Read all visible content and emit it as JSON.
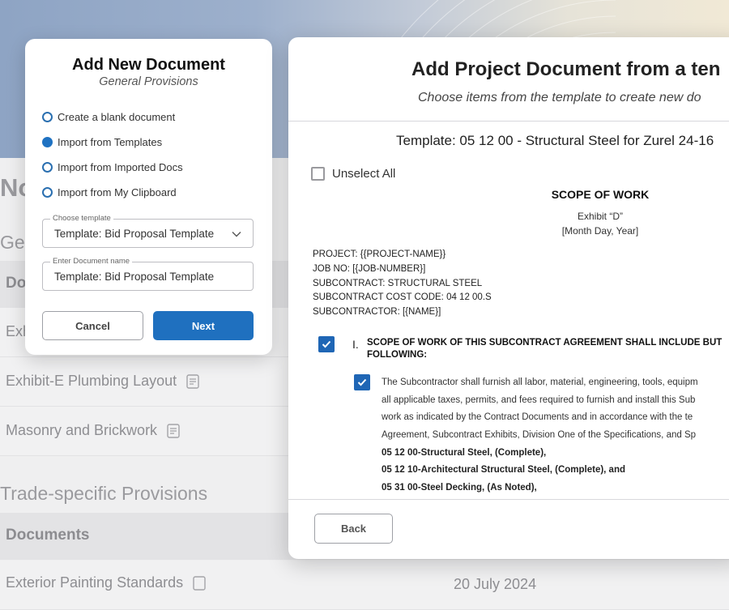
{
  "background": {
    "page_title": "No",
    "section1": "Ge",
    "section1_header": "Do",
    "rows": [
      "Exh",
      "Exhibit-E Plumbing Layout",
      "Masonry and Brickwork"
    ],
    "section2": "Trade-specific Provisions",
    "section2_header": "Documents",
    "bottom_row": "Exterior Painting Standards",
    "bottom_date": "20 July 2024"
  },
  "add_new_modal": {
    "title": "Add New Document",
    "subtitle": "General Provisions",
    "options": [
      {
        "label": "Create a blank document",
        "selected": false
      },
      {
        "label": "Import from Templates",
        "selected": true
      },
      {
        "label": "Import from Imported Docs",
        "selected": false
      },
      {
        "label": "Import from My Clipboard",
        "selected": false
      }
    ],
    "template_field": {
      "label": "Choose template",
      "value": "Template: Bid Proposal Template"
    },
    "name_field": {
      "label": "Enter Document name",
      "value": "Template: Bid Proposal Template"
    },
    "cancel_label": "Cancel",
    "next_label": "Next"
  },
  "template_modal": {
    "title": "Add Project Document from a ten",
    "subtitle": "Choose items from the template to create new do",
    "template_line": "Template: 05 12 00 - Structural Steel for Zurel 24-16",
    "unselect_label": "Unselect All",
    "doc_heading": "SCOPE OF WORK",
    "exhibit": "Exhibit “D”",
    "date_placeholder": "[Month Day, Year]",
    "meta": [
      "PROJECT:   {{PROJECT-NAME}}",
      "JOB NO:    [{JOB-NUMBER}]",
      "SUBCONTRACT: STRUCTURAL STEEL",
      "SUBCONTRACT COST CODE: 04 12 00.S",
      "SUBCONTRACTOR: [{NAME}]"
    ],
    "section_num": "I.",
    "section_head_1": "SCOPE OF WORK OF THIS SUBCONTRACT AGREEMENT SHALL INCLUDE BUT",
    "section_head_2": "FOLLOWING:",
    "para_lines": [
      "The Subcontractor shall furnish all labor, material, engineering, tools, equipm",
      "all applicable taxes, permits, and fees required to furnish and install this Sub",
      "work as indicated by the Contract Documents and in accordance with the te",
      "Agreement, Subcontract Exhibits, Division One of the Specifications, and Sp"
    ],
    "bold_lines": [
      "05 12 00-Structural Steel, (Complete),",
      "05 12 10-Architectural Structural Steel, (Complete), and",
      "05 31 00-Steel Decking, (As Noted),"
    ],
    "back_label": "Back"
  }
}
